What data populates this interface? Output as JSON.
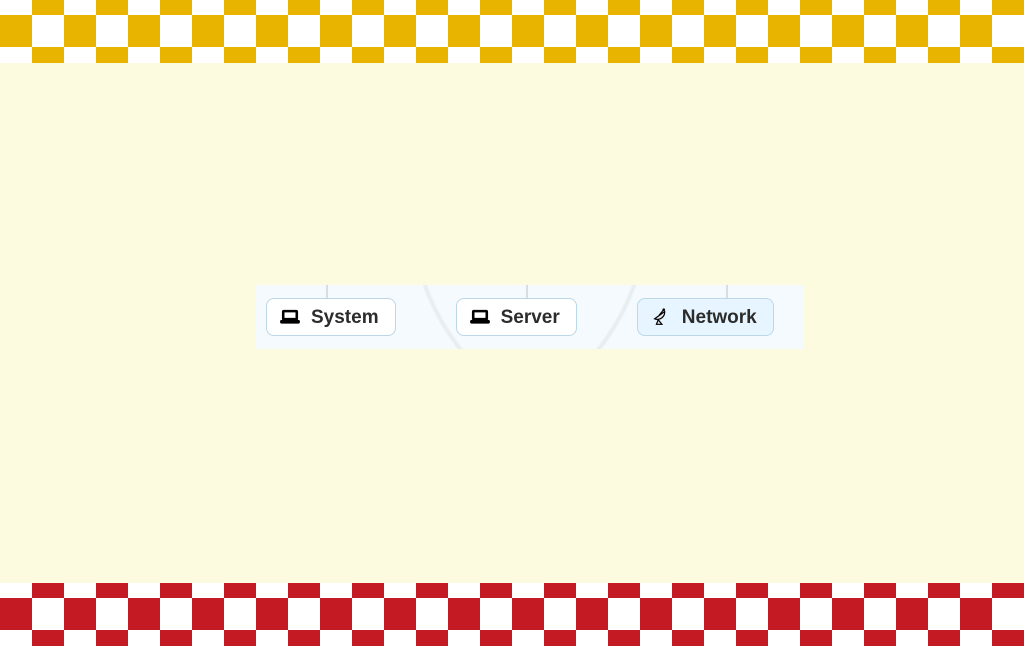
{
  "buttons": {
    "system": {
      "label": "System",
      "icon": "laptop",
      "selected": false
    },
    "server": {
      "label": "Server",
      "icon": "laptop",
      "selected": false
    },
    "network": {
      "label": "Network",
      "icon": "satellite-dish",
      "selected": true
    }
  },
  "colors": {
    "page_bg": "#fdfbdf",
    "checker_top": "#e9b400",
    "checker_bottom": "#c31a24",
    "panel_bg": "#f5fafe",
    "pill_border": "#bcd7e6",
    "pill_selected_bg": "#e6f5ff"
  }
}
